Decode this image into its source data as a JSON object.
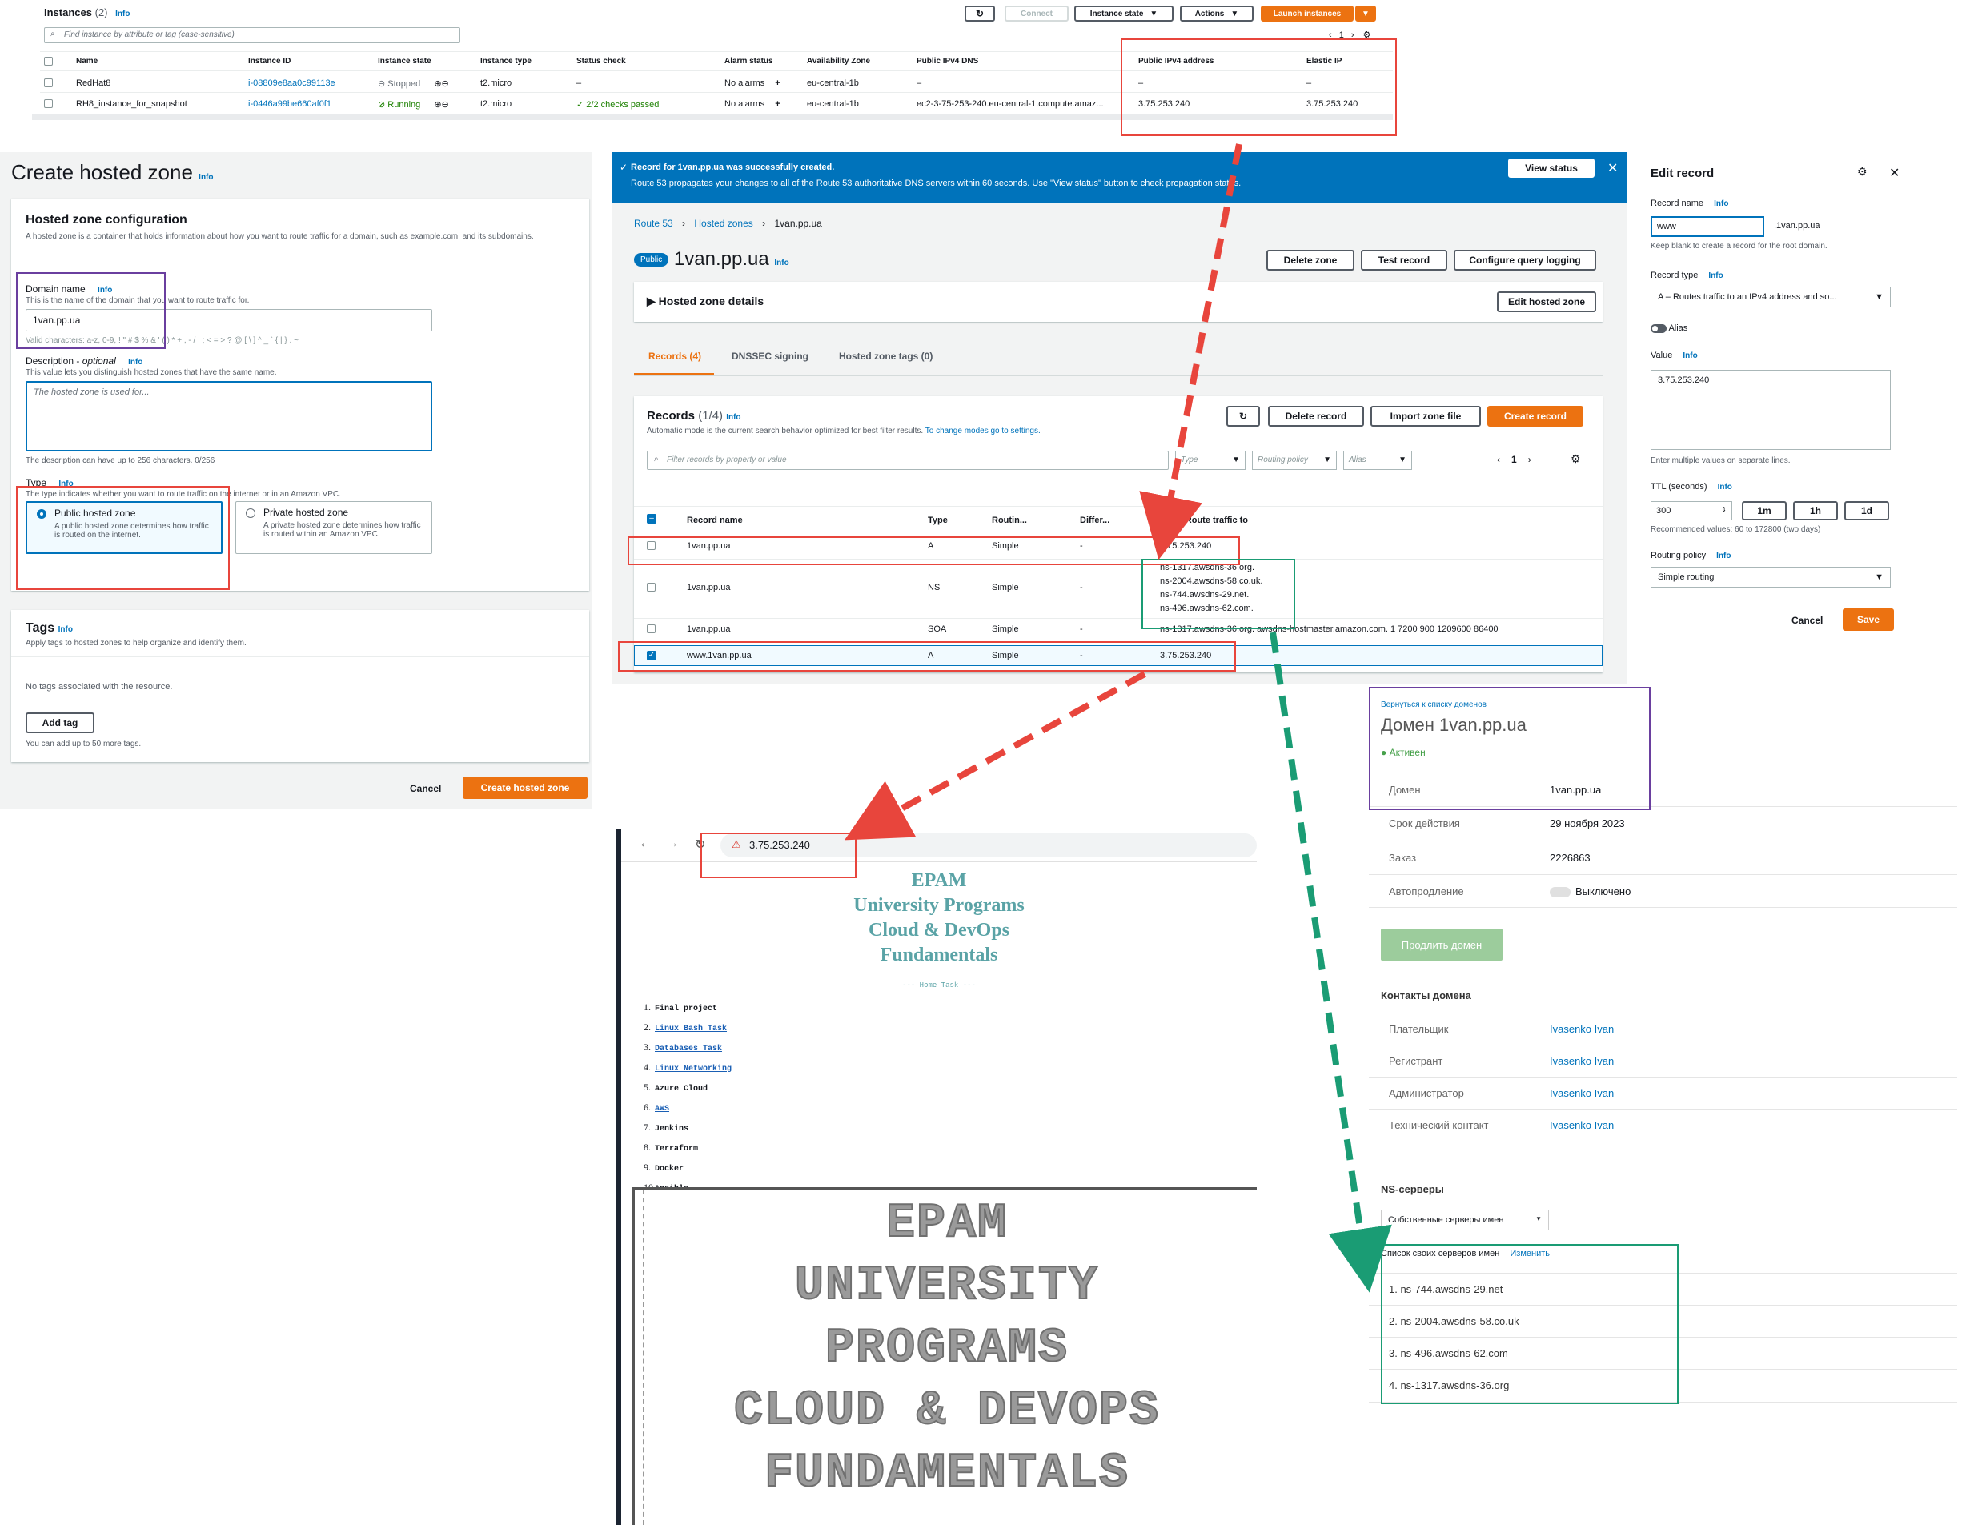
{
  "instances": {
    "title": "Instances",
    "count": "(2)",
    "info": "Info",
    "search_placeholder": "Find instance by attribute or tag (case-sensitive)",
    "btn_connect": "Connect",
    "btn_state": "Instance state",
    "btn_actions": "Actions",
    "btn_launch": "Launch instances",
    "page": "1",
    "columns": [
      "Name",
      "Instance ID",
      "Instance state",
      "Instance type",
      "Status check",
      "Alarm status",
      "Availability Zone",
      "Public IPv4 DNS",
      "Public IPv4 address",
      "Elastic IP"
    ],
    "rows": [
      {
        "name": "RedHat8",
        "id": "i-08809e8aa0c99113e",
        "state": "Stopped",
        "type": "t2.micro",
        "status": "–",
        "alarm": "No alarms",
        "az": "eu-central-1b",
        "dns": "–",
        "ip": "–",
        "eip": "–"
      },
      {
        "name": "RH8_instance_for_snapshot",
        "id": "i-0446a99be660af0f1",
        "state": "Running",
        "type": "t2.micro",
        "status": "2/2 checks passed",
        "alarm": "No alarms",
        "az": "eu-central-1b",
        "dns": "ec2-3-75-253-240.eu-central-1.compute.amaz...",
        "ip": "3.75.253.240",
        "eip": "3.75.253.240"
      }
    ]
  },
  "create_zone": {
    "title": "Create hosted zone",
    "info": "Info",
    "config_title": "Hosted zone configuration",
    "config_desc": "A hosted zone is a container that holds information about how you want to route traffic for a domain, such as example.com, and its subdomains.",
    "domain_label": "Domain name",
    "domain_help": "This is the name of the domain that you want to route traffic for.",
    "domain_value": "1van.pp.ua",
    "domain_valid": "Valid characters: a-z, 0-9, ! \" # $ % & ' ( ) * + , - / : ; < = > ? @ [ \\ ] ^ _ ` { | } . ~",
    "desc_label": "Description",
    "desc_optional": "optional",
    "desc_help": "This value lets you distinguish hosted zones that have the same name.",
    "desc_placeholder": "The hosted zone is used for...",
    "desc_limit": "The description can have up to 256 characters. 0/256",
    "type_label": "Type",
    "type_help": "The type indicates whether you want to route traffic on the internet or in an Amazon VPC.",
    "public_title": "Public hosted zone",
    "public_desc": "A public hosted zone determines how traffic is routed on the internet.",
    "private_title": "Private hosted zone",
    "private_desc": "A private hosted zone determines how traffic is routed within an Amazon VPC.",
    "tags_title": "Tags",
    "tags_desc": "Apply tags to hosted zones to help organize and identify them.",
    "no_tags": "No tags associated with the resource.",
    "add_tag": "Add tag",
    "tags_limit": "You can add up to 50 more tags.",
    "cancel": "Cancel",
    "create": "Create hosted zone"
  },
  "r53": {
    "banner_title": "Record for 1van.pp.ua was successfully created.",
    "banner_text": "Route 53 propagates your changes to all of the Route 53 authoritative DNS servers within 60 seconds. Use \"View status\" button to check propagation status.",
    "view_status": "View status",
    "breadcrumb": [
      "Route 53",
      "Hosted zones",
      "1van.pp.ua"
    ],
    "badge": "Public",
    "zone": "1van.pp.ua",
    "info": "Info",
    "delete_zone": "Delete zone",
    "test_record": "Test record",
    "config_logging": "Configure query logging",
    "details": "Hosted zone details",
    "edit_zone": "Edit hosted zone",
    "tabs": [
      "Records (4)",
      "DNSSEC signing",
      "Hosted zone tags (0)"
    ],
    "records_title": "Records",
    "records_count": "(1/4)",
    "records_desc": "Automatic mode is the current search behavior optimized for best filter results.",
    "records_link": "To change modes go to settings.",
    "delete_record": "Delete record",
    "import": "Import zone file",
    "create_record": "Create record",
    "filter_placeholder": "Filter records by property or value",
    "filter_type": "Type",
    "filter_policy": "Routing policy",
    "filter_alias": "Alias",
    "page": "1",
    "columns": [
      "Record name",
      "Type",
      "Routin...",
      "Differ...",
      "Value/Route traffic to"
    ],
    "rows": [
      {
        "name": "1van.pp.ua",
        "type": "A",
        "policy": "Simple",
        "diff": "-",
        "value": [
          "3.75.253.240"
        ]
      },
      {
        "name": "1van.pp.ua",
        "type": "NS",
        "policy": "Simple",
        "diff": "-",
        "value": [
          "ns-1317.awsdns-36.org.",
          "ns-2004.awsdns-58.co.uk.",
          "ns-744.awsdns-29.net.",
          "ns-496.awsdns-62.com."
        ]
      },
      {
        "name": "1van.pp.ua",
        "type": "SOA",
        "policy": "Simple",
        "diff": "-",
        "value": [
          "ns-1317.awsdns-36.org. awsdns-hostmaster.amazon.com. 1 7200 900 1209600 86400"
        ]
      },
      {
        "name": "www.1van.pp.ua",
        "type": "A",
        "policy": "Simple",
        "diff": "-",
        "value": [
          "3.75.253.240"
        ]
      }
    ]
  },
  "edit_record": {
    "title": "Edit record",
    "name_label": "Record name",
    "info": "Info",
    "name_value": "www",
    "suffix": ".1van.pp.ua",
    "name_help": "Keep blank to create a record for the root domain.",
    "type_label": "Record type",
    "type_value": "A – Routes traffic to an IPv4 address and so...",
    "alias": "Alias",
    "value_label": "Value",
    "value": "3.75.253.240",
    "value_help": "Enter multiple values on separate lines.",
    "ttl_label": "TTL (seconds)",
    "ttl": "300",
    "ttl_1m": "1m",
    "ttl_1h": "1h",
    "ttl_1d": "1d",
    "ttl_help": "Recommended values: 60 to 172800 (two days)",
    "policy_label": "Routing policy",
    "policy_value": "Simple routing",
    "cancel": "Cancel",
    "save": "Save"
  },
  "browser": {
    "url": "3.75.253.240",
    "h1": [
      "EPAM",
      "University Programs",
      "Cloud & DevOps",
      "Fundamentals"
    ],
    "subtitle": "--- Home Task ---",
    "list": [
      {
        "n": "1.",
        "t": "Final project",
        "link": false
      },
      {
        "n": "2.",
        "t": "Linux Bash Task",
        "link": true
      },
      {
        "n": "3.",
        "t": "Databases Task",
        "link": true
      },
      {
        "n": "4.",
        "t": "Linux Networking",
        "link": true
      },
      {
        "n": "5.",
        "t": "Azure Cloud",
        "link": false
      },
      {
        "n": "6.",
        "t": "AWS",
        "link": true
      },
      {
        "n": "7.",
        "t": "Jenkins",
        "link": false
      },
      {
        "n": "8.",
        "t": "Terraform",
        "link": false
      },
      {
        "n": "9.",
        "t": "Docker",
        "link": false
      },
      {
        "n": "10.",
        "t": "Ansible",
        "link": false
      }
    ],
    "ascii": [
      "EPAM",
      "UNIVERSITY",
      "PROGRAMS",
      "CLOUD & DEVOPS",
      "FUNDAMENTALS"
    ]
  },
  "registrar": {
    "back": "Вернуться к списку доменов",
    "title": "Домен 1van.pp.ua",
    "status": "Активен",
    "rows": [
      {
        "label": "Домен",
        "value": "1van.pp.ua"
      },
      {
        "label": "Срок действия",
        "value": "29 ноября 2023"
      },
      {
        "label": "Заказ",
        "value": "2226863"
      },
      {
        "label": "Автопродление",
        "value": "Выключено"
      }
    ],
    "renew": "Продлить домен",
    "contacts_title": "Контакты домена",
    "contacts": [
      {
        "label": "Плательщик",
        "value": "Ivasenko Ivan"
      },
      {
        "label": "Регистрант",
        "value": "Ivasenko Ivan"
      },
      {
        "label": "Администратор",
        "value": "Ivasenko Ivan"
      },
      {
        "label": "Технический контакт",
        "value": "Ivasenko Ivan"
      }
    ],
    "ns_title": "NS-серверы",
    "ns_select": "Собственные серверы имен",
    "ns_list_title": "Список своих серверов имен",
    "ns_change": "Изменить",
    "ns": [
      "1. ns-744.awsdns-29.net",
      "2. ns-2004.awsdns-58.co.uk",
      "3. ns-496.awsdns-62.com",
      "4. ns-1317.awsdns-36.org"
    ]
  },
  "colors": {
    "orange": "#ec7211",
    "blue": "#0073bb",
    "red": "#e8453c",
    "green": "#1a9c74",
    "purple": "#6a3f9f"
  }
}
